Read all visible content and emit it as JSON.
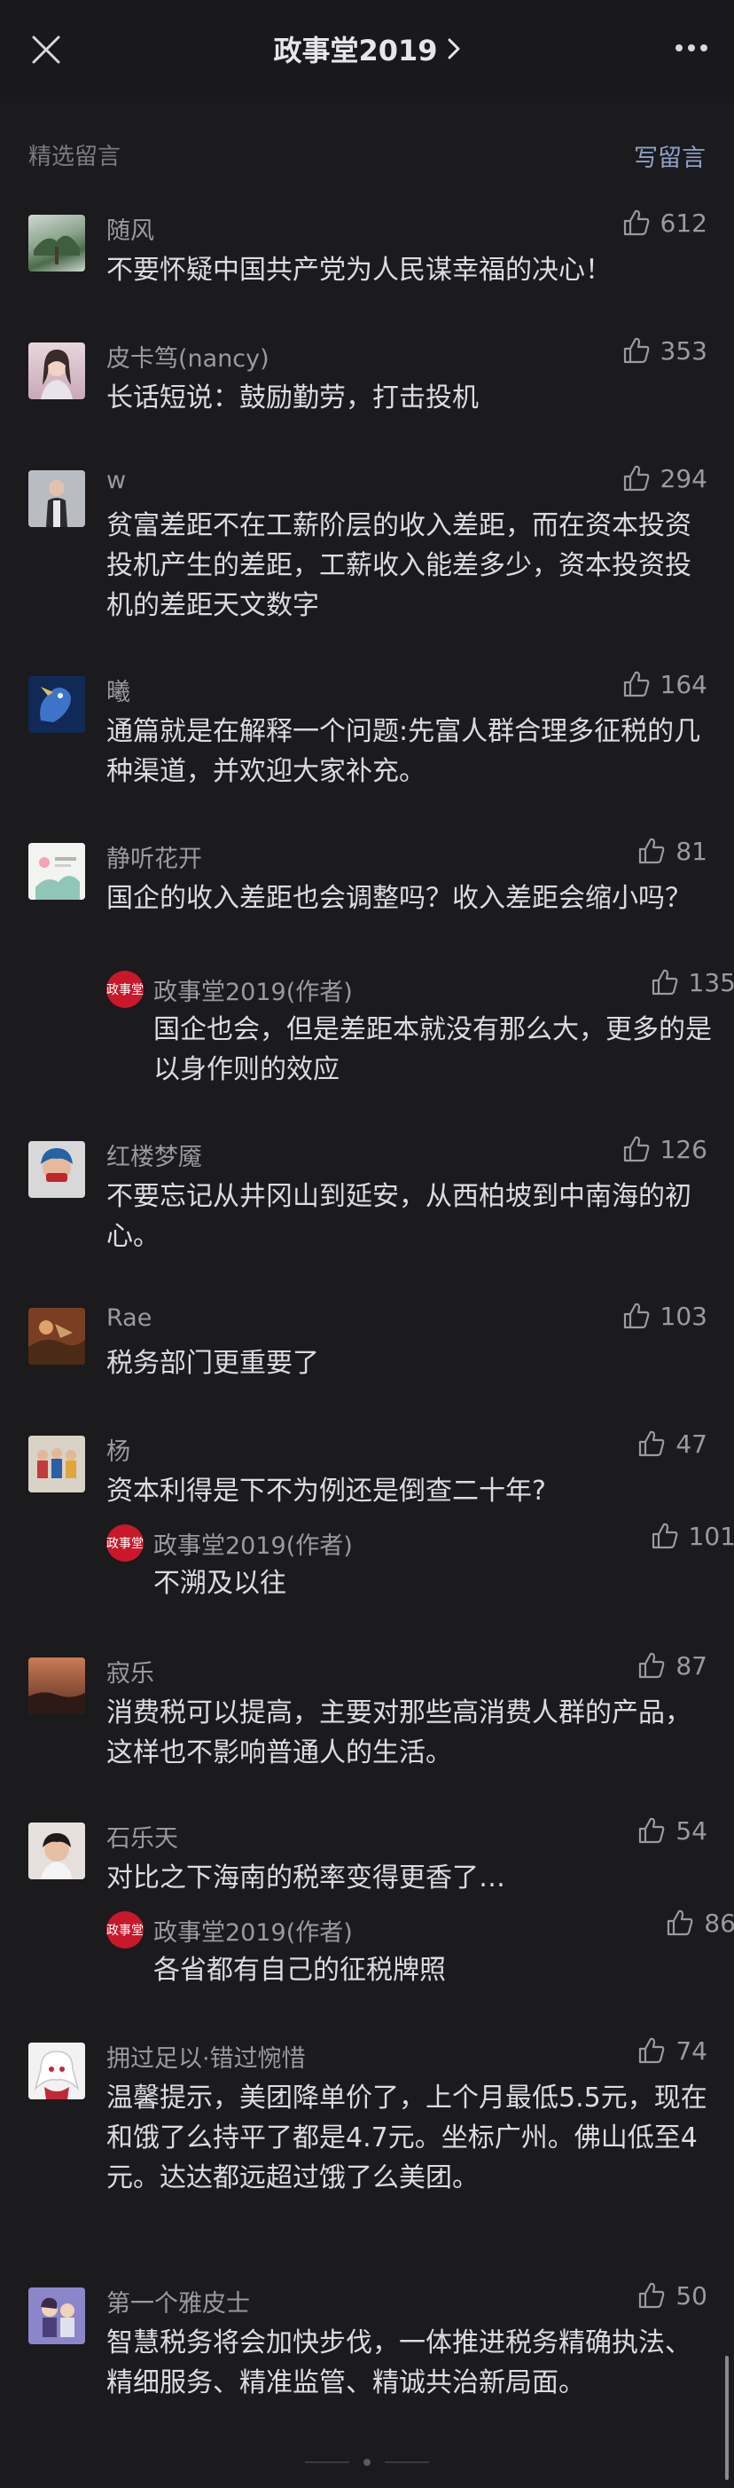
{
  "header": {
    "title": "政事堂2019",
    "close_icon": "close-icon",
    "more_icon": "more-icon"
  },
  "section": {
    "title": "精选留言",
    "write_label": "写留言"
  },
  "colors": {
    "background": "#1b1a1d",
    "link": "#8ea1c8",
    "author_badge": "#c9182a"
  },
  "comments": [
    {
      "name": "随风",
      "likes": "612",
      "content": "不要怀疑中国共产党为人民谋幸福的决心！"
    },
    {
      "name": "皮卡笃(nancy)",
      "likes": "353",
      "content": "长话短说：鼓励勤劳，打击投机"
    },
    {
      "name": "w",
      "likes": "294",
      "content": "贫富差距不在工薪阶层的收入差距，而在资本投资投机产生的差距，工薪收入能差多少，资本投资投机的差距天文数字"
    },
    {
      "name": "曦",
      "likes": "164",
      "content": "通篇就是在解释一个问题:先富人群合理多征税的几种渠道，并欢迎大家补充。"
    },
    {
      "name": "静听花开",
      "likes": "81",
      "content": "国企的收入差距也会调整吗？收入差距会缩小吗？",
      "reply": {
        "name": "政事堂2019(作者)",
        "likes": "135",
        "content": "国企也会，但是差距本就没有那么大，更多的是以身作则的效应",
        "avatar_text": "政事堂"
      }
    },
    {
      "name": "红楼梦魇",
      "likes": "126",
      "content": "不要忘记从井冈山到延安，从西柏坡到中南海的初心。"
    },
    {
      "name": "Rae",
      "likes": "103",
      "content": "税务部门更重要了"
    },
    {
      "name": "杨",
      "likes": "47",
      "content": "资本利得是下不为例还是倒查二十年?",
      "reply": {
        "name": "政事堂2019(作者)",
        "likes": "101",
        "content": "不溯及以往",
        "avatar_text": "政事堂"
      }
    },
    {
      "name": "寂乐",
      "likes": "87",
      "content": "消费税可以提高，主要对那些高消费人群的产品，这样也不影响普通人的生活。"
    },
    {
      "name": "石乐天",
      "likes": "54",
      "content": "对比之下海南的税率变得更香了…",
      "reply": {
        "name": "政事堂2019(作者)",
        "likes": "86",
        "content": "各省都有自己的征税牌照",
        "avatar_text": "政事堂"
      }
    },
    {
      "name": "拥过足以·错过惋惜",
      "likes": "74",
      "content": "温馨提示，美团降单价了，上个月最低5.5元，现在和饿了么持平了都是4.7元。坐标广州。佛山低至4元。达达都远超过饿了么美团。"
    },
    {
      "name": "第一个雅皮士",
      "likes": "50",
      "content": "智慧税务将会加快步伐，一体推进税务精确执法、精细服务、精准监管、精诚共治新局面。"
    }
  ]
}
